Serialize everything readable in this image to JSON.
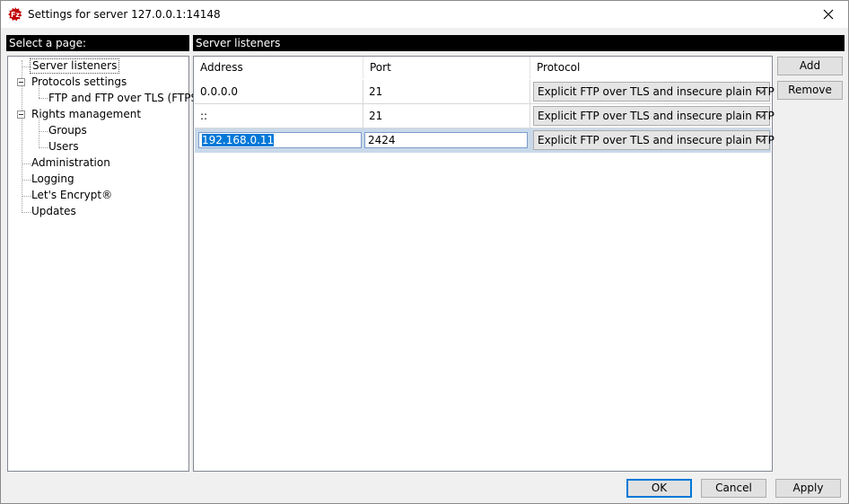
{
  "window": {
    "title": "Settings for server 127.0.0.1:14148"
  },
  "left_panel": {
    "header": "Select a page:",
    "tree": [
      {
        "label": "Server listeners"
      },
      {
        "label": "Protocols settings"
      },
      {
        "label": "FTP and FTP over TLS (FTPS)"
      },
      {
        "label": "Rights management"
      },
      {
        "label": "Groups"
      },
      {
        "label": "Users"
      },
      {
        "label": "Administration"
      },
      {
        "label": "Logging"
      },
      {
        "label": "Let's Encrypt®"
      },
      {
        "label": "Updates"
      }
    ]
  },
  "right_panel": {
    "header": "Server listeners",
    "columns": [
      "Address",
      "Port",
      "Protocol"
    ],
    "rows": [
      {
        "address": "0.0.0.0",
        "port": "21",
        "protocol": "Explicit FTP over TLS and insecure plain FTP"
      },
      {
        "address": "::",
        "port": "21",
        "protocol": "Explicit FTP over TLS and insecure plain FTP"
      },
      {
        "address": "192.168.0.11",
        "port": "2424",
        "protocol": "Explicit FTP over TLS and insecure plain FTP"
      }
    ],
    "add_label": "Add",
    "remove_label": "Remove"
  },
  "footer": {
    "ok_label": "OK",
    "cancel_label": "Cancel",
    "apply_label": "Apply"
  },
  "colors": {
    "header_bg": "#000000",
    "selection": "#0078d7",
    "app_icon": "#bf0000"
  },
  "icons": {
    "app": "filezilla-server-icon",
    "close": "close-icon",
    "expand": "collapse-minus-icon",
    "dropdown": "chevron-down-icon"
  }
}
